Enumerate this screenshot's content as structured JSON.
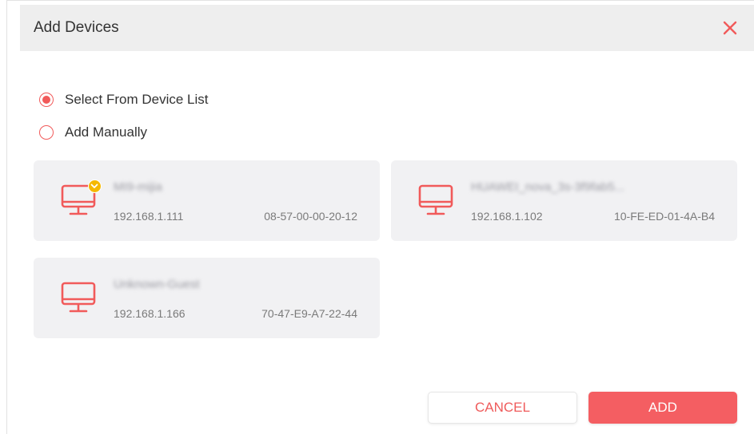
{
  "dialog": {
    "title": "Add Devices",
    "close_icon": "close-icon"
  },
  "options": [
    {
      "label": "Select From Device List",
      "selected": true
    },
    {
      "label": "Add Manually",
      "selected": false
    }
  ],
  "devices": [
    {
      "name": "MI9-mijia",
      "ip": "192.168.1.111",
      "mac": "08-57-00-00-20-12",
      "icon": "computer-icon",
      "badge": "crown-icon"
    },
    {
      "name": "HUAWEI_nova_3s-3f9fab5...",
      "ip": "192.168.1.102",
      "mac": "10-FE-ED-01-4A-B4",
      "icon": "computer-icon"
    },
    {
      "name": "Unknown-Guest",
      "ip": "192.168.1.166",
      "mac": "70-47-E9-A7-22-44",
      "icon": "computer-icon"
    }
  ],
  "buttons": {
    "cancel": "CANCEL",
    "add": "ADD"
  },
  "colors": {
    "accent": "#f45e62",
    "card_bg": "#f1f1f3",
    "header_bg": "#eeeeee",
    "badge": "#f5b800"
  }
}
